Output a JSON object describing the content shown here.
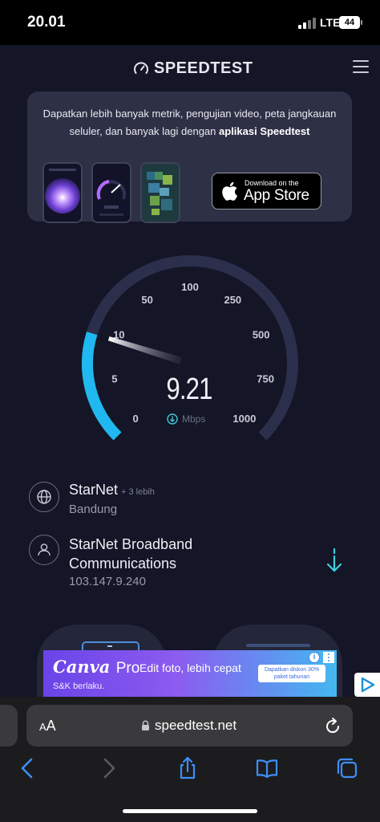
{
  "status_bar": {
    "time": "20.01",
    "network": "LTE",
    "battery": "44"
  },
  "header": {
    "brand": "SPEEDTEST",
    "brand_icon": "speedometer-icon",
    "menu_icon": "hamburger-menu-icon"
  },
  "promo": {
    "text_plain": "Dapatkan lebih banyak metrik, pengujian video, peta jangkauan seluler, dan banyak lagi dengan ",
    "text_bold": "aplikasi Speedtest",
    "appstore_small": "Download on the",
    "appstore_big": "App Store"
  },
  "gauge": {
    "tick_labels": [
      "0",
      "5",
      "10",
      "50",
      "100",
      "250",
      "500",
      "750",
      "1000"
    ],
    "speed": 9.21,
    "speed_label": "9.21",
    "unit": "Mbps",
    "scale_max": 1000,
    "accent_color": "#1fb8f0",
    "track_color": "#2b2f4b"
  },
  "server": {
    "name": "StarNet",
    "more": "+ 3 lebih",
    "location": "Bandung",
    "icon": "globe-icon"
  },
  "provider": {
    "name": "StarNet Broadband Communications",
    "ip": "103.147.9.240",
    "icon": "user-icon",
    "action_icon": "download-arrow-icon"
  },
  "ad": {
    "brand": "Canva",
    "brand_suffix": "Pro",
    "subtext": "S&K berlaku.",
    "cta": "Edit foto, lebih cepat",
    "badge_line1": "Dapatkan diskon 30%",
    "badge_line2": "paket tahunan",
    "info_label": "i"
  },
  "browser": {
    "text_size_small": "A",
    "text_size_big": "A",
    "url": "speedtest.net",
    "toolbar": [
      "back-icon",
      "forward-icon",
      "share-icon",
      "bookmarks-icon",
      "tabs-icon"
    ]
  }
}
